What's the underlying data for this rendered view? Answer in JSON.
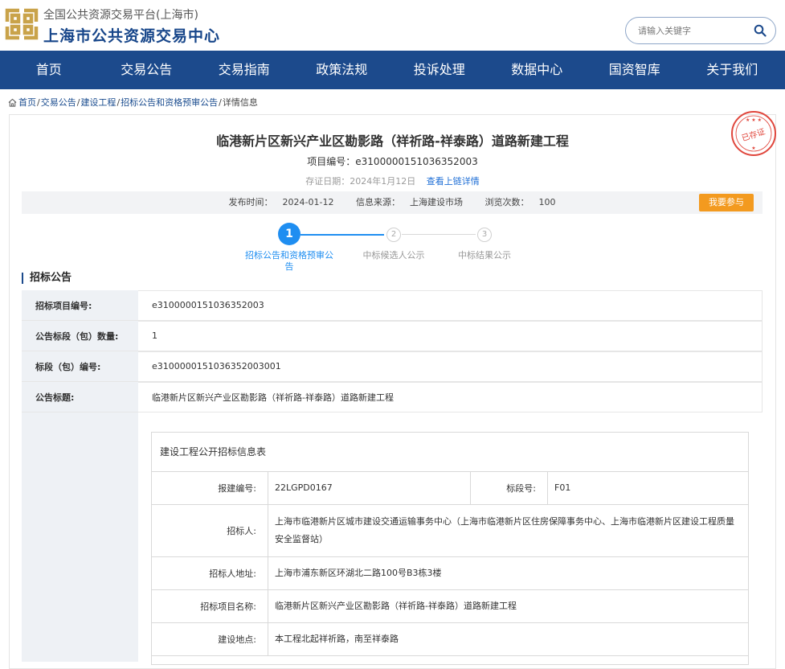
{
  "header": {
    "site_sub": "全国公共资源交易平台(上海市)",
    "site_title": "上海市公共资源交易中心",
    "search_placeholder": "请输入关键字"
  },
  "nav": [
    "首页",
    "交易公告",
    "交易指南",
    "政策法规",
    "投诉处理",
    "数据中心",
    "国资智库",
    "关于我们"
  ],
  "breadcrumb": {
    "items": [
      "首页",
      "交易公告",
      "建设工程",
      "招标公告和资格预审公告"
    ],
    "current": "详情信息"
  },
  "project": {
    "title": "临港新片区新兴产业区勘影路（祥祈路-祥泰路）道路新建工程",
    "code_label": "项目编号：",
    "code": "e3100000151036352003",
    "deposit_label": "存证日期：",
    "deposit_date": "2024年1月12日",
    "chain_link": "查看上链详情",
    "stamp_text": "已存证"
  },
  "info_bar": {
    "publish_label": "发布时间：",
    "publish_time": "2024-01-12",
    "source_label": "信息来源：",
    "source": "上海建设市场",
    "views_label": "浏览次数：",
    "views": "100",
    "join_button": "我要参与"
  },
  "steps": [
    {
      "num": "1",
      "label": "招标公告和资格预审公告",
      "active": true
    },
    {
      "num": "2",
      "label": "中标候选人公示",
      "active": false
    },
    {
      "num": "3",
      "label": "中标结果公示",
      "active": false
    }
  ],
  "section_title": "招标公告",
  "main_table": [
    {
      "label": "招标项目编号:",
      "value": "e3100000151036352003"
    },
    {
      "label": "公告标段（包）数量:",
      "value": "1"
    },
    {
      "label": "标段（包）编号:",
      "value": "e3100000151036352003001"
    },
    {
      "label": "公告标题:",
      "value": "临港新片区新兴产业区勘影路（祥祈路-祥泰路）道路新建工程"
    }
  ],
  "inner_table": {
    "caption": "建设工程公开招标信息表",
    "report_label": "报建编号:",
    "report_no": "22LGPD0167",
    "section_label": "标段号:",
    "section_no": "F01",
    "tenderer_label": "招标人:",
    "tenderer": "上海市临港新片区城市建设交通运输事务中心（上海市临港新片区住房保障事务中心、上海市临港新片区建设工程质量安全监督站）",
    "address_label": "招标人地址:",
    "address": "上海市浦东新区环湖北二路100号B3栋3楼",
    "project_name_label": "招标项目名称:",
    "project_name": "临港新片区新兴产业区勘影路（祥祈路-祥泰路）道路新建工程",
    "location_label": "建设地点:",
    "location": "本工程北起祥祈路，南至祥泰路"
  },
  "colors": {
    "nav_bg": "#1c4a8c",
    "accent_blue": "#1f8ef1",
    "join_orange": "#f39a1f",
    "stamp_red": "#e0463c"
  }
}
